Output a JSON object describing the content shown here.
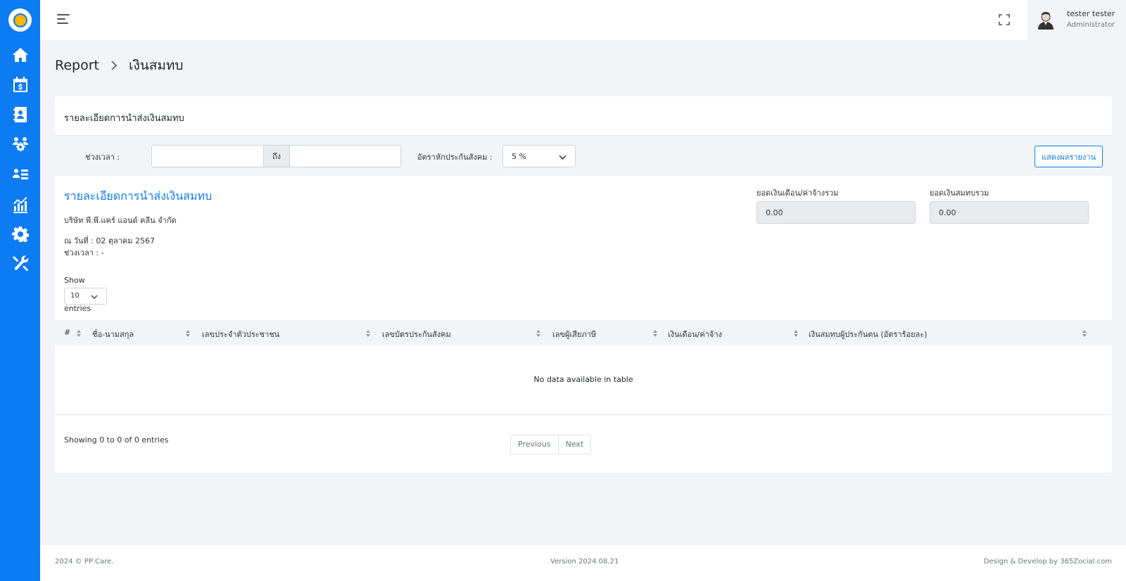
{
  "sidebar": {
    "icons": [
      "home-icon",
      "calendar-dollar-icon",
      "contacts-book-icon",
      "users-gear-icon",
      "user-list-icon",
      "chart-report-icon",
      "settings-gear-icon",
      "tools-icon"
    ]
  },
  "topbar": {
    "user_name": "tester tester",
    "user_role": "Administrator"
  },
  "breadcrumb": {
    "parent": "Report",
    "current": "เงินสมทบ"
  },
  "card": {
    "title": "รายละเอียดการนำส่งเงินสมทบ"
  },
  "filters": {
    "period_label": "ช่วงเวลา :",
    "date_from": "",
    "to_label": "ถึง",
    "date_to": "",
    "rate_label": "อัตราหักประกันสังคม :",
    "rate_value": "5 %",
    "show_button": "แสดงผลรายงาน"
  },
  "report": {
    "title": "รายละเอียดการนำส่งเงินสมทบ",
    "company": "บริษัท พี.พี.แคร์ แอนด์ คลีน จำกัด",
    "as_of": "ณ วันที่ : 02 ตุลาคม 2567",
    "period": "ช่วงเวลา : -",
    "sum_salary_label": "ยอดเงินเดือน/ค่าจ้างรวม",
    "sum_salary_value": "0.00",
    "sum_contribution_label": "ยอดเงินสมทบรวม",
    "sum_contribution_value": "0.00"
  },
  "table": {
    "show_label": "Show",
    "page_length": "10",
    "entries_label": "entries",
    "columns": [
      "#",
      "ชื่อ-นามสกุล",
      "เลขประจำตัวประชาชน",
      "เลขบัตรประกันสังคม",
      "เลขผู้เสียภาษี",
      "เงินเดือน/ค่าจ้าง",
      "เงินสมทบผู้ประกันตน (อัตราร้อยละ)"
    ],
    "empty_message": "No data available in table",
    "info": "Showing 0 to 0 of 0 entries",
    "previous": "Previous",
    "next": "Next"
  },
  "footer": {
    "copyright": "2024 © PP Care.",
    "version": "Version 2024.08.21",
    "credit": "Design & Develop by 365Zocial.com"
  },
  "colors": {
    "primary": "#0d7cf2",
    "background": "#f3f4f8"
  }
}
